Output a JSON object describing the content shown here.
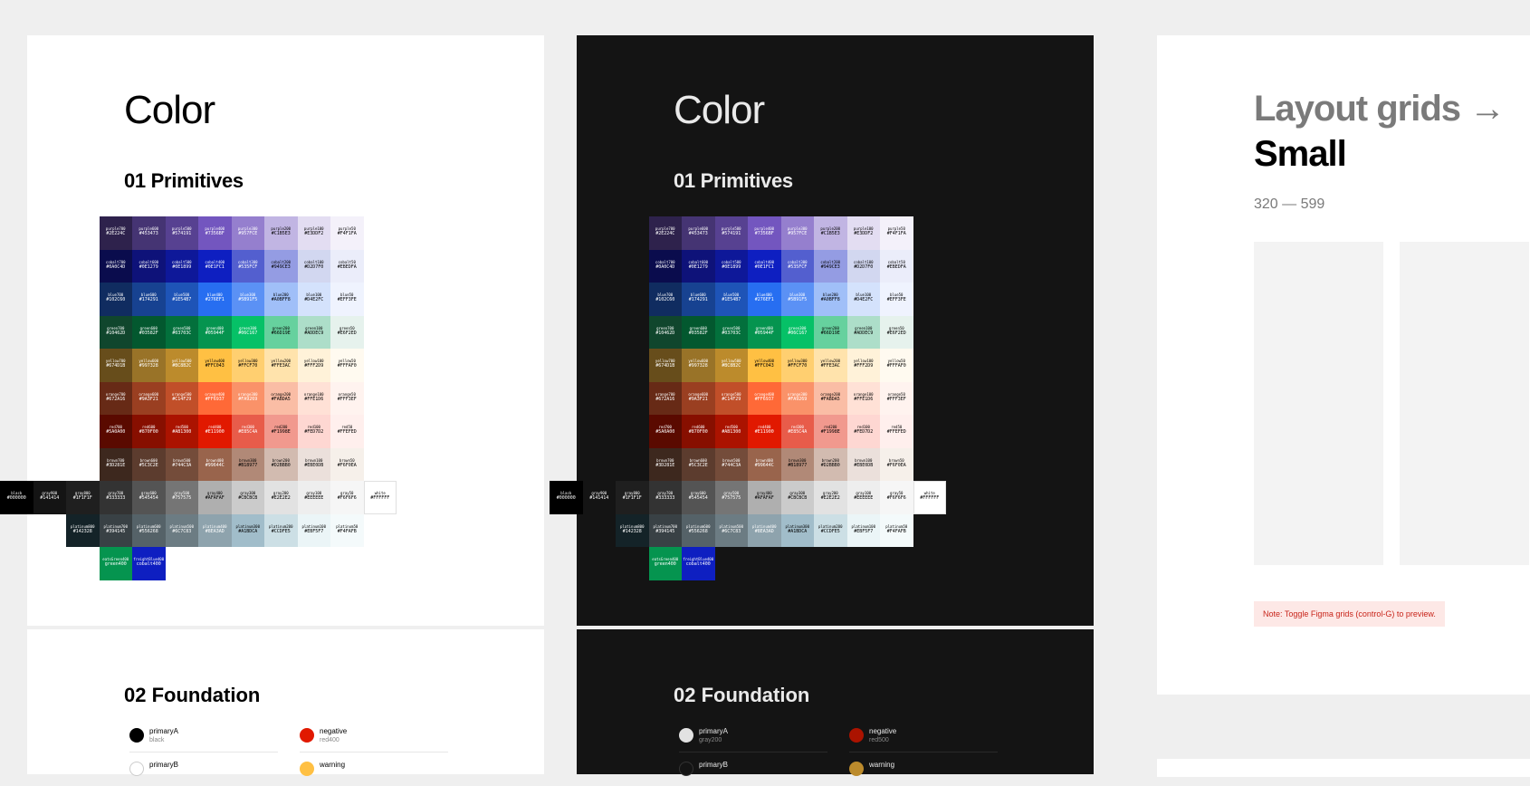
{
  "light_panel": {
    "title": "Color",
    "primitives_heading": "01 Primitives",
    "foundation_heading": "02 Foundation",
    "tokens": [
      {
        "name": "primaryA",
        "value": "black",
        "color": "#000000"
      },
      {
        "name": "primaryB",
        "value": "",
        "color": "#ffffff"
      },
      {
        "name": "negative",
        "value": "red400",
        "color": "#E11900"
      },
      {
        "name": "warning",
        "value": "",
        "color": "#FFC043"
      }
    ]
  },
  "dark_panel": {
    "title": "Color",
    "primitives_heading": "01 Primitives",
    "foundation_heading": "02 Foundation",
    "tokens": [
      {
        "name": "primaryA",
        "value": "gray200",
        "color": "#E2E2E2"
      },
      {
        "name": "primaryB",
        "value": "",
        "color": "#141414"
      },
      {
        "name": "negative",
        "value": "red500",
        "color": "#AB1300"
      },
      {
        "name": "warning",
        "value": "",
        "color": "#BC8B2C"
      }
    ]
  },
  "layout_panel": {
    "title_line1": "Layout grids →",
    "title_line2": "Small",
    "range": "320 — 599",
    "note": "Note: Toggle Figma grids (control-G) to preview."
  },
  "palette": {
    "rows": [
      {
        "family": "purple",
        "cells": [
          {
            "name": "purple700",
            "hex": "#2E224C",
            "text": "#ffffff"
          },
          {
            "name": "purple600",
            "hex": "#453473",
            "text": "#ffffff"
          },
          {
            "name": "purple500",
            "hex": "#574191",
            "text": "#ffffff"
          },
          {
            "name": "purple400",
            "hex": "#7356BF",
            "text": "#ffffff"
          },
          {
            "name": "purple300",
            "hex": "#957FCE",
            "text": "#ffffff"
          },
          {
            "name": "purple200",
            "hex": "#C1B5E3",
            "text": "#000000"
          },
          {
            "name": "purple100",
            "hex": "#E3DDF2",
            "text": "#000000"
          },
          {
            "name": "purple50",
            "hex": "#F4F1FA",
            "text": "#000000"
          }
        ]
      },
      {
        "family": "cobalt",
        "cells": [
          {
            "name": "cobalt700",
            "hex": "#0A0C4D",
            "text": "#ffffff"
          },
          {
            "name": "cobalt600",
            "hex": "#0E1279",
            "text": "#ffffff"
          },
          {
            "name": "cobalt500",
            "hex": "#0E1899",
            "text": "#ffffff"
          },
          {
            "name": "cobalt400",
            "hex": "#0E1FC1",
            "text": "#ffffff"
          },
          {
            "name": "cobalt300",
            "hex": "#535FCF",
            "text": "#ffffff"
          },
          {
            "name": "cobalt200",
            "hex": "#949CE3",
            "text": "#000000"
          },
          {
            "name": "cobalt100",
            "hex": "#D2D7F0",
            "text": "#000000"
          },
          {
            "name": "cobalt50",
            "hex": "#EBEDFA",
            "text": "#000000"
          }
        ]
      },
      {
        "family": "blue",
        "cells": [
          {
            "name": "blue700",
            "hex": "#102C60",
            "text": "#ffffff"
          },
          {
            "name": "blue600",
            "hex": "#174291",
            "text": "#ffffff"
          },
          {
            "name": "blue500",
            "hex": "#1E54B7",
            "text": "#ffffff"
          },
          {
            "name": "blue400",
            "hex": "#276EF1",
            "text": "#ffffff"
          },
          {
            "name": "blue300",
            "hex": "#5B91F5",
            "text": "#ffffff"
          },
          {
            "name": "blue200",
            "hex": "#A0BFF8",
            "text": "#000000"
          },
          {
            "name": "blue100",
            "hex": "#D4E2FC",
            "text": "#000000"
          },
          {
            "name": "blue50",
            "hex": "#EFF3FE",
            "text": "#000000"
          }
        ]
      },
      {
        "family": "green",
        "cells": [
          {
            "name": "green700",
            "hex": "#10462D",
            "text": "#ffffff"
          },
          {
            "name": "green600",
            "hex": "#03582F",
            "text": "#ffffff"
          },
          {
            "name": "green500",
            "hex": "#03703C",
            "text": "#ffffff"
          },
          {
            "name": "green400",
            "hex": "#05944F",
            "text": "#ffffff"
          },
          {
            "name": "green300",
            "hex": "#06C167",
            "text": "#ffffff"
          },
          {
            "name": "green200",
            "hex": "#66D19E",
            "text": "#000000"
          },
          {
            "name": "green100",
            "hex": "#ADDEC9",
            "text": "#000000"
          },
          {
            "name": "green50",
            "hex": "#E6F2ED",
            "text": "#000000"
          }
        ]
      },
      {
        "family": "yellow",
        "cells": [
          {
            "name": "yellow700",
            "hex": "#674D1B",
            "text": "#ffffff"
          },
          {
            "name": "yellow600",
            "hex": "#997328",
            "text": "#ffffff"
          },
          {
            "name": "yellow500",
            "hex": "#BC8B2C",
            "text": "#ffffff"
          },
          {
            "name": "yellow400",
            "hex": "#FFC043",
            "text": "#000000"
          },
          {
            "name": "yellow300",
            "hex": "#FFCF70",
            "text": "#000000"
          },
          {
            "name": "yellow200",
            "hex": "#FFE3AC",
            "text": "#000000"
          },
          {
            "name": "yellow100",
            "hex": "#FFF2D9",
            "text": "#000000"
          },
          {
            "name": "yellow50",
            "hex": "#FFFAF0",
            "text": "#000000"
          }
        ]
      },
      {
        "family": "orange",
        "cells": [
          {
            "name": "orange700",
            "hex": "#672A16",
            "text": "#ffffff"
          },
          {
            "name": "orange600",
            "hex": "#9A3F21",
            "text": "#ffffff"
          },
          {
            "name": "orange500",
            "hex": "#C14F29",
            "text": "#ffffff"
          },
          {
            "name": "orange400",
            "hex": "#FF6937",
            "text": "#ffffff"
          },
          {
            "name": "orange300",
            "hex": "#FA9269",
            "text": "#ffffff"
          },
          {
            "name": "orange200",
            "hex": "#FABDA5",
            "text": "#000000"
          },
          {
            "name": "orange100",
            "hex": "#FFE1D6",
            "text": "#000000"
          },
          {
            "name": "orange50",
            "hex": "#FFF3EF",
            "text": "#000000"
          }
        ]
      },
      {
        "family": "red",
        "cells": [
          {
            "name": "red700",
            "hex": "#5A0A00",
            "text": "#ffffff"
          },
          {
            "name": "red600",
            "hex": "#870F00",
            "text": "#ffffff"
          },
          {
            "name": "red500",
            "hex": "#AB1300",
            "text": "#ffffff"
          },
          {
            "name": "red400",
            "hex": "#E11900",
            "text": "#ffffff"
          },
          {
            "name": "red300",
            "hex": "#E85C4A",
            "text": "#ffffff"
          },
          {
            "name": "red200",
            "hex": "#F1998E",
            "text": "#000000"
          },
          {
            "name": "red100",
            "hex": "#FED7D2",
            "text": "#000000"
          },
          {
            "name": "red50",
            "hex": "#FFEFED",
            "text": "#000000"
          }
        ]
      },
      {
        "family": "brown",
        "cells": [
          {
            "name": "brown700",
            "hex": "#3D281E",
            "text": "#ffffff"
          },
          {
            "name": "brown600",
            "hex": "#5C3C2E",
            "text": "#ffffff"
          },
          {
            "name": "brown500",
            "hex": "#744C3A",
            "text": "#ffffff"
          },
          {
            "name": "brown400",
            "hex": "#99644C",
            "text": "#ffffff"
          },
          {
            "name": "brown300",
            "hex": "#B18977",
            "text": "#000000"
          },
          {
            "name": "brown200",
            "hex": "#D2BBB0",
            "text": "#000000"
          },
          {
            "name": "brown100",
            "hex": "#EBE0DB",
            "text": "#000000"
          },
          {
            "name": "brown50",
            "hex": "#F6F0EA",
            "text": "#000000"
          }
        ]
      },
      {
        "family": "gray",
        "cells": [
          {
            "name": "black",
            "hex": "#000000",
            "text": "#ffffff"
          },
          {
            "name": "gray900",
            "hex": "#141414",
            "text": "#ffffff"
          },
          {
            "name": "gray800",
            "hex": "#1F1F1F",
            "text": "#ffffff"
          },
          {
            "name": "gray700",
            "hex": "#333333",
            "text": "#ffffff"
          },
          {
            "name": "gray600",
            "hex": "#545454",
            "text": "#ffffff"
          },
          {
            "name": "gray500",
            "hex": "#757575",
            "text": "#ffffff"
          },
          {
            "name": "gray400",
            "hex": "#AFAFAF",
            "text": "#000000"
          },
          {
            "name": "gray300",
            "hex": "#CBCBCB",
            "text": "#000000"
          },
          {
            "name": "gray200",
            "hex": "#E2E2E2",
            "text": "#000000"
          },
          {
            "name": "gray100",
            "hex": "#EEEEEE",
            "text": "#000000"
          },
          {
            "name": "gray50",
            "hex": "#F6F6F6",
            "text": "#000000"
          },
          {
            "name": "white",
            "hex": "#FFFFFF",
            "text": "#000000"
          }
        ]
      },
      {
        "family": "platinum",
        "cells": [
          {
            "name": "platinum800",
            "hex": "#142328",
            "text": "#ffffff"
          },
          {
            "name": "platinum700",
            "hex": "#394145",
            "text": "#ffffff"
          },
          {
            "name": "platinum600",
            "hex": "#556268",
            "text": "#ffffff"
          },
          {
            "name": "platinum500",
            "hex": "#6C7C83",
            "text": "#ffffff"
          },
          {
            "name": "platinum400",
            "hex": "#8EA3AD",
            "text": "#ffffff"
          },
          {
            "name": "platinum300",
            "hex": "#A1BDCA",
            "text": "#000000"
          },
          {
            "name": "platinum200",
            "hex": "#CCDFE5",
            "text": "#000000"
          },
          {
            "name": "platinum100",
            "hex": "#EBF5F7",
            "text": "#000000"
          },
          {
            "name": "platinum50",
            "hex": "#F4FAFB",
            "text": "#000000"
          }
        ]
      },
      {
        "family": "brand",
        "cells": [
          {
            "name": "eatsGreen400",
            "hex": "green400",
            "text": "#ffffff",
            "fill": "#05944F"
          },
          {
            "name": "freightBlue400",
            "hex": "cobalt400",
            "text": "#ffffff",
            "fill": "#0E1FC1"
          }
        ]
      }
    ]
  }
}
